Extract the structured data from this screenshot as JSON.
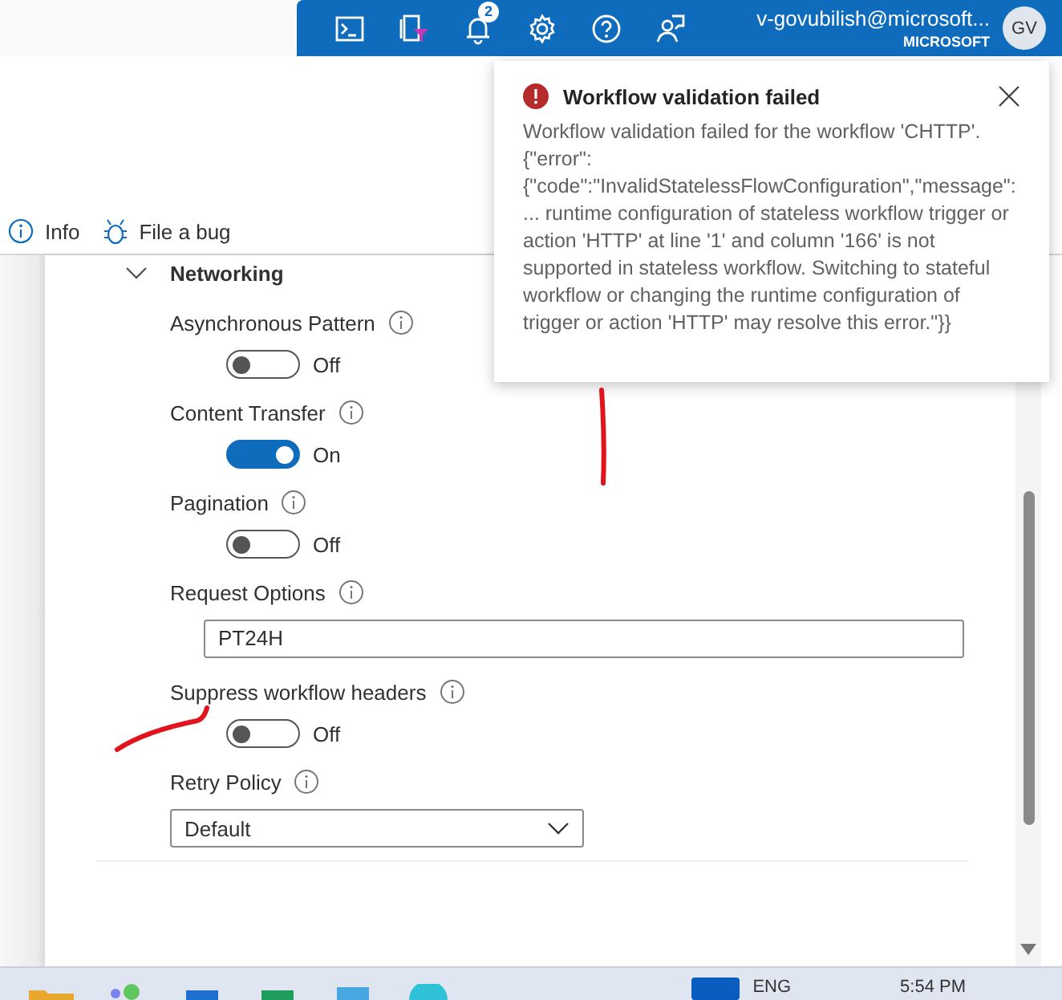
{
  "header": {
    "notification_count": "2",
    "account_name": "v-govubilish@microsoft...",
    "account_org": "MICROSOFT",
    "avatar_initials": "GV"
  },
  "toolbar": [
    {
      "kind": "info",
      "label": "Info"
    },
    {
      "kind": "bug",
      "label": "File a bug"
    }
  ],
  "section": {
    "title": "Networking",
    "expanded": true
  },
  "settings": [
    {
      "kind": "toggle",
      "label": "Asynchronous Pattern",
      "on": false,
      "state_label": "Off"
    },
    {
      "kind": "toggle",
      "label": "Content Transfer",
      "on": true,
      "state_label": "On"
    },
    {
      "kind": "toggle",
      "label": "Pagination",
      "on": false,
      "state_label": "Off"
    },
    {
      "kind": "text",
      "label": "Request Options",
      "value": "PT24H"
    },
    {
      "kind": "toggle",
      "label": "Suppress workflow headers",
      "on": false,
      "state_label": "Off"
    },
    {
      "kind": "dropdown",
      "label": "Retry Policy",
      "value": "Default"
    }
  ],
  "toast": {
    "kind": "error",
    "title": "Workflow validation failed",
    "message": "Workflow validation failed for the workflow 'CHTTP'. {\"error\": {\"code\":\"InvalidStatelessFlowConfiguration\",\"message\":... runtime configuration of stateless workflow trigger or action 'HTTP' at line '1' and column '166' is not supported in stateless workflow. Switching to stateful workflow or changing the runtime configuration of trigger or action 'HTTP' may resolve this error.\"}}"
  },
  "taskbar": {
    "language": "ENG",
    "time": "5:54 PM"
  }
}
